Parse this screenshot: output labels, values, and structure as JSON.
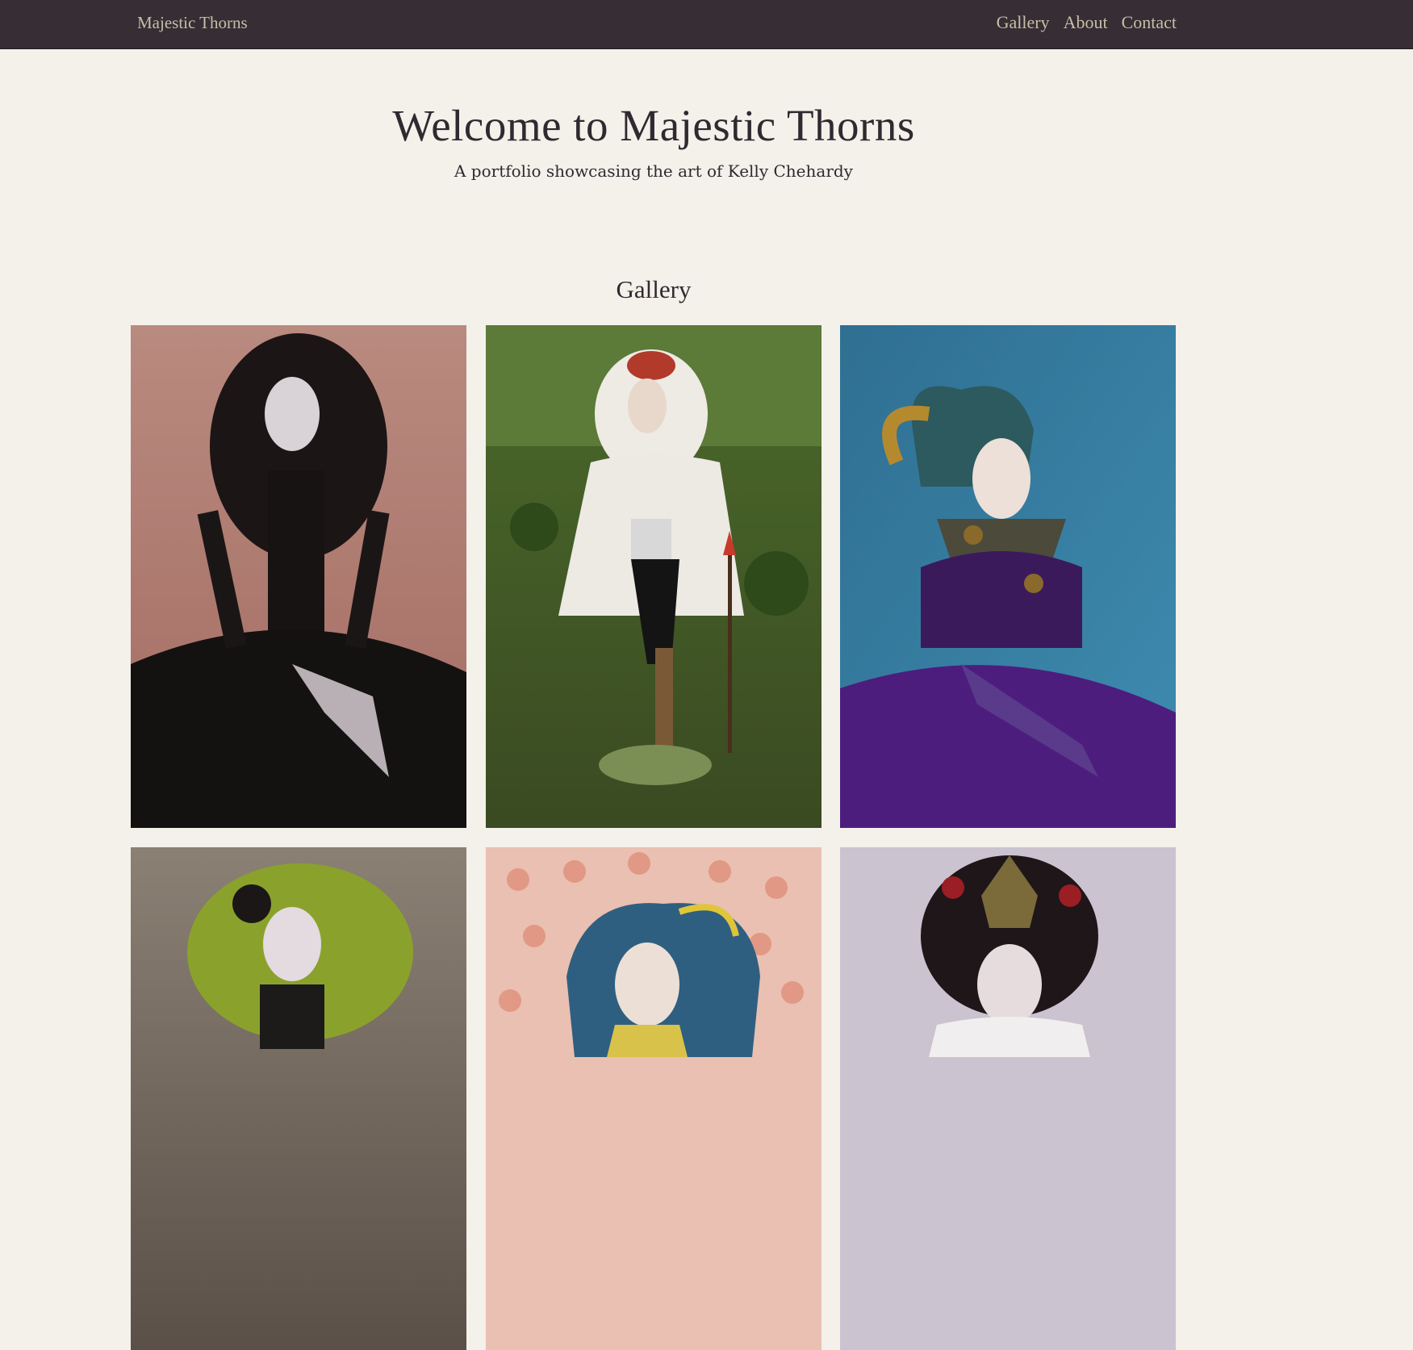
{
  "nav": {
    "brand": "Majestic Thorns",
    "links": [
      "Gallery",
      "About",
      "Contact"
    ]
  },
  "hero": {
    "title": "Welcome to Majestic Thorns",
    "subtitle": "A portfolio showcasing the art of Kelly Chehardy"
  },
  "gallery": {
    "title": "Gallery",
    "items": [
      {
        "subject": "gothic-doll-black-hair",
        "bg": "#b48378",
        "hair": "#1a1414",
        "outfit": "#151212"
      },
      {
        "subject": "forest-warrior-doll-white-fur",
        "bg": "#3f5a25",
        "hair": "#4a2a22",
        "outfit": "#e9e7e2"
      },
      {
        "subject": "harlequin-doll-purple-dress",
        "bg": "#2f7c9f",
        "hair": "#2a5f66",
        "outfit": "#4b1d7a"
      },
      {
        "subject": "doll-green-hair",
        "bg": "#7a6f63",
        "hair": "#8aa02e",
        "outfit": "#1d1a1a"
      },
      {
        "subject": "doll-blue-hair-dotted-background",
        "bg": "#e7b8a8",
        "hair": "#2f5f80",
        "outfit": "#d9c24a"
      },
      {
        "subject": "doll-black-hair-gold-tiara",
        "bg": "#c9c0cd",
        "hair": "#1e1618",
        "outfit": "#f0ecee"
      }
    ]
  }
}
